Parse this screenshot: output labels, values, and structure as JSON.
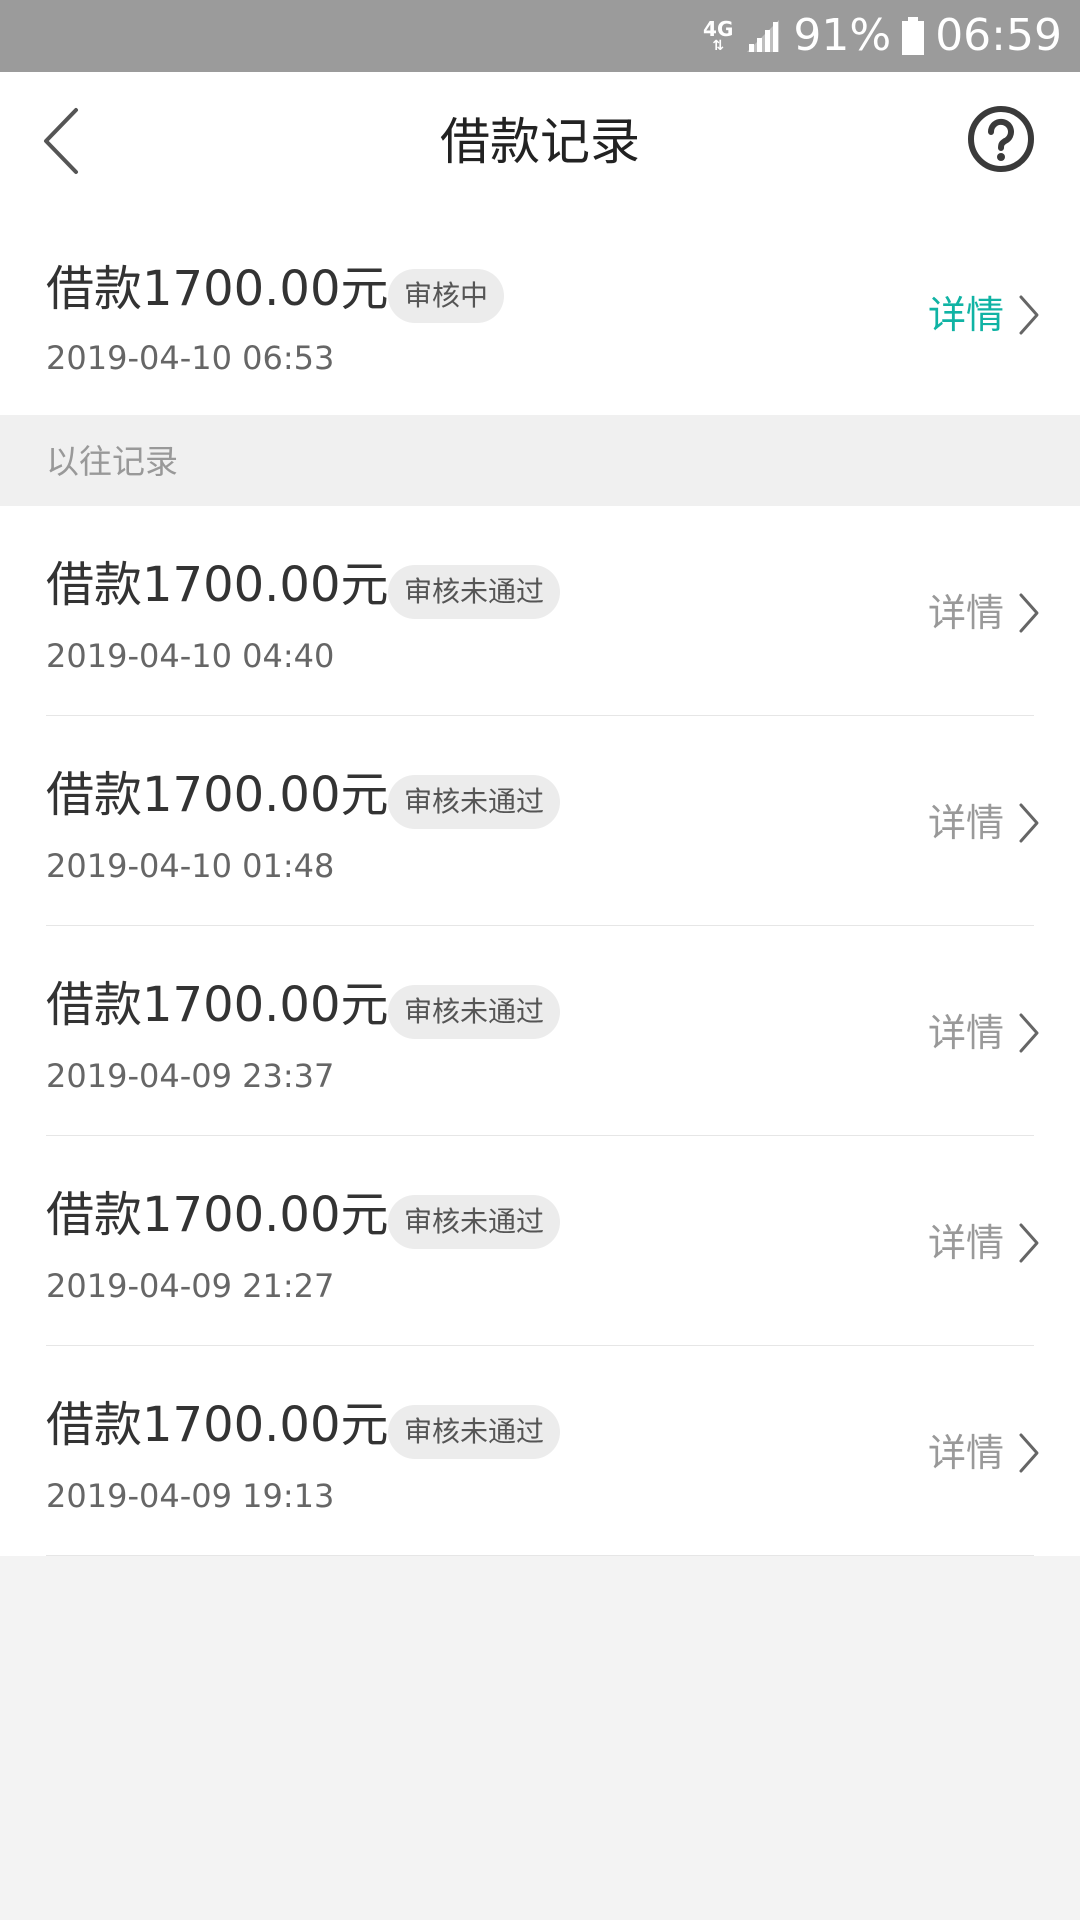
{
  "status_bar": {
    "network": "4G",
    "signal_icon": "signal-icon",
    "battery_percent": "91%",
    "battery_icon": "battery-icon",
    "time": "06:59"
  },
  "nav": {
    "title": "借款记录",
    "back_icon": "back-arrow-icon",
    "help_icon": "question-circle-icon"
  },
  "current_record": {
    "amount": "借款1700.00元",
    "status": "审核中",
    "date": "2019-04-10 06:53",
    "detail_label": "详情"
  },
  "history": {
    "header": "以往记录",
    "records": [
      {
        "amount": "借款1700.00元",
        "status": "审核未通过",
        "date": "2019-04-10 04:40",
        "detail_label": "详情"
      },
      {
        "amount": "借款1700.00元",
        "status": "审核未通过",
        "date": "2019-04-10 01:48",
        "detail_label": "详情"
      },
      {
        "amount": "借款1700.00元",
        "status": "审核未通过",
        "date": "2019-04-09 23:37",
        "detail_label": "详情"
      },
      {
        "amount": "借款1700.00元",
        "status": "审核未通过",
        "date": "2019-04-09 21:27",
        "detail_label": "详情"
      },
      {
        "amount": "借款1700.00元",
        "status": "审核未通过",
        "date": "2019-04-09 19:13",
        "detail_label": "详情"
      }
    ]
  },
  "colors": {
    "accent": "#10b3a4",
    "status_bar": "#9b9b9b",
    "background": "#f3f3f3"
  }
}
